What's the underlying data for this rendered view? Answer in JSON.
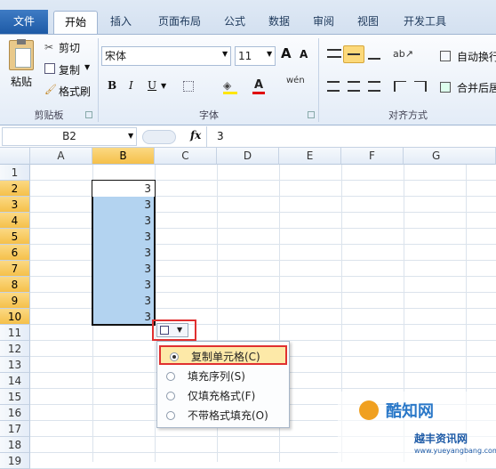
{
  "tabs": [
    "文件",
    "开始",
    "插入",
    "页面布局",
    "公式",
    "数据",
    "审阅",
    "视图",
    "开发工具"
  ],
  "clipboard": {
    "paste": "粘贴",
    "cut": "剪切",
    "copy": "复制",
    "format_painter": "格式刷",
    "group": "剪贴板"
  },
  "font": {
    "name": "宋体",
    "size": "11",
    "bold": "B",
    "italic": "I",
    "underline": "U",
    "grow": "A",
    "shrink": "A",
    "group": "字体",
    "phonetic": "wén"
  },
  "alignment": {
    "wrap": "自动换行",
    "merge": "合并后居",
    "group": "对齐方式"
  },
  "formula_bar": {
    "name_box": "B2",
    "fx": "fx",
    "value": "3"
  },
  "columns": [
    "A",
    "B",
    "C",
    "D",
    "E",
    "F",
    "G"
  ],
  "rows": [
    "1",
    "2",
    "3",
    "4",
    "5",
    "6",
    "7",
    "8",
    "9",
    "10",
    "11",
    "12",
    "13",
    "14",
    "15",
    "16",
    "17",
    "18",
    "19"
  ],
  "cells": [
    "3",
    "3",
    "3",
    "3",
    "3",
    "3",
    "3",
    "3",
    "3"
  ],
  "autofill_menu": [
    "复制单元格(C)",
    "填充序列(S)",
    "仅填充格式(F)",
    "不带格式填充(O)"
  ],
  "watermark": {
    "brand": "酷知网",
    "sub": "越丰资讯网",
    "url": "www.yueyangbang.com"
  },
  "colors": {
    "accent": "#1d5aa6",
    "selection": "#b3d3f0",
    "highlight_border": "#e03030",
    "menu_hover": "#fde9a8"
  }
}
